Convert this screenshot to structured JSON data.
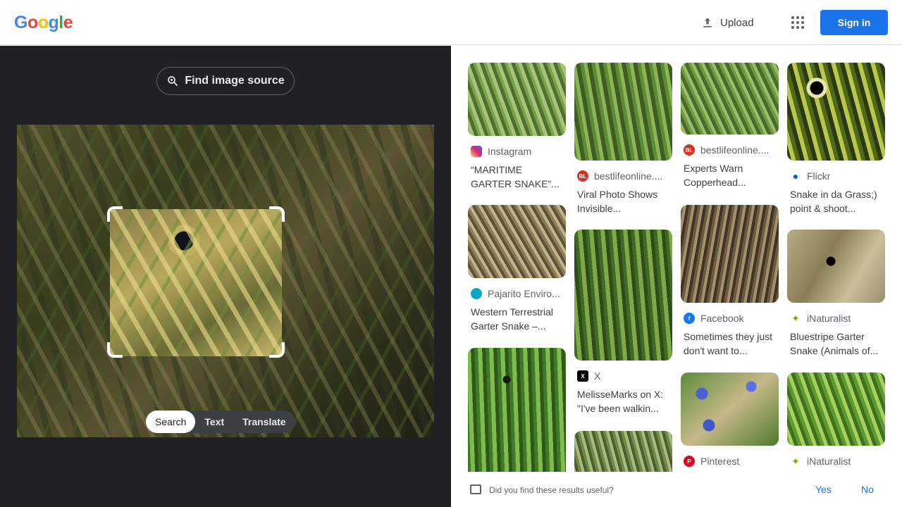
{
  "header": {
    "logo_letters": [
      "G",
      "o",
      "o",
      "g",
      "l",
      "e"
    ],
    "logo_colors": [
      "#4285F4",
      "#EA4335",
      "#FBBC05",
      "#4285F4",
      "#34A853",
      "#EA4335"
    ],
    "upload_label": "Upload",
    "signin_label": "Sign in"
  },
  "left": {
    "find_source_label": "Find image source",
    "modes": [
      "Search",
      "Text",
      "Translate"
    ],
    "active_mode": "Search"
  },
  "results": [
    {
      "source": "Instagram",
      "icon": "instagram-icon",
      "icon_color": "#d6249f",
      "title": "“MARITIME GARTER SNAKE”..."
    },
    {
      "source": "bestlifeonline....",
      "icon": "bestlifeonline-icon",
      "icon_color": "#d93025",
      "title": "Viral Photo Shows Invisible..."
    },
    {
      "source": "bestlifeonline....",
      "icon": "bestlifeonline-icon",
      "icon_color": "#d93025",
      "title": "Experts Warn Copperhead..."
    },
    {
      "source": "Flickr",
      "icon": "flickr-icon",
      "icon_color": "#0063dc",
      "title": "Snake in da Grass;) point & shoot..."
    },
    {
      "source": "Pajarito Enviro...",
      "icon": "pajarito-icon",
      "icon_color": "#12a4c6",
      "title": "Western Terrestrial Garter Snake –..."
    },
    {
      "source": "X",
      "icon": "x-icon",
      "icon_color": "#000000",
      "title": "MelisseMarks on X: \"I've been walkin..."
    },
    {
      "source": "Facebook",
      "icon": "facebook-icon",
      "icon_color": "#1877f2",
      "title": "Sometimes they just don't want to..."
    },
    {
      "source": "iNaturalist",
      "icon": "inaturalist-icon",
      "icon_color": "#74ac00",
      "title": "Bluestripe Garter Snake (Animals of..."
    },
    {
      "source": "Pinterest",
      "icon": "pinterest-icon",
      "icon_color": "#e60023",
      "title": ""
    },
    {
      "source": "iNaturalist",
      "icon": "inaturalist-icon",
      "icon_color": "#74ac00",
      "title": ""
    }
  ],
  "feedback": {
    "question": "Did you find these results useful?",
    "yes": "Yes",
    "no": "No"
  }
}
